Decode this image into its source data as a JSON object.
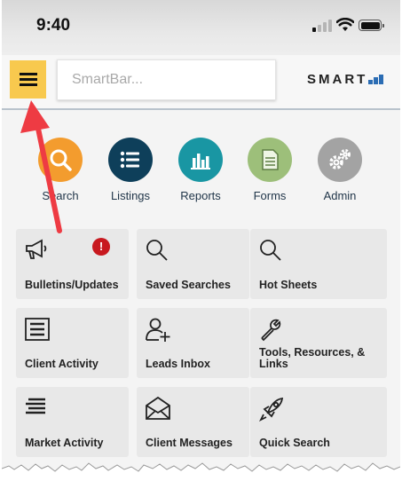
{
  "status_bar": {
    "time": "9:40"
  },
  "header": {
    "menu_icon": "hamburger-menu-icon",
    "smartbar_placeholder": "SmartBar...",
    "logo_text": "SMART",
    "accent_color": "#f8c94e",
    "logo_bar_color": "#2b6db4"
  },
  "nav": [
    {
      "label": "Search",
      "icon": "search-icon",
      "color": "#f39c2e"
    },
    {
      "label": "Listings",
      "icon": "list-icon",
      "color": "#0e3f5a"
    },
    {
      "label": "Reports",
      "icon": "bar-chart-icon",
      "color": "#1996a3"
    },
    {
      "label": "Forms",
      "icon": "document-icon",
      "color": "#9dbf7a"
    },
    {
      "label": "Admin",
      "icon": "gears-icon",
      "color": "#a3a3a3"
    }
  ],
  "tiles": [
    {
      "label": "Bulletins/Updates",
      "icon": "megaphone-icon",
      "badge": "!"
    },
    {
      "label": "Saved Searches",
      "icon": "search-icon"
    },
    {
      "label": "Hot Sheets",
      "icon": "search-icon"
    },
    {
      "label": "Client Activity",
      "icon": "activity-list-icon"
    },
    {
      "label": "Leads Inbox",
      "icon": "add-user-icon"
    },
    {
      "label": "Tools, Resources, & Links",
      "icon": "wrench-icon"
    },
    {
      "label": "Market Activity",
      "icon": "lines-icon"
    },
    {
      "label": "Client Messages",
      "icon": "envelope-icon"
    },
    {
      "label": "Quick Search",
      "icon": "rocket-icon"
    }
  ],
  "annotation_arrow_color": "#ee3b43",
  "badge_color": "#c8191f"
}
